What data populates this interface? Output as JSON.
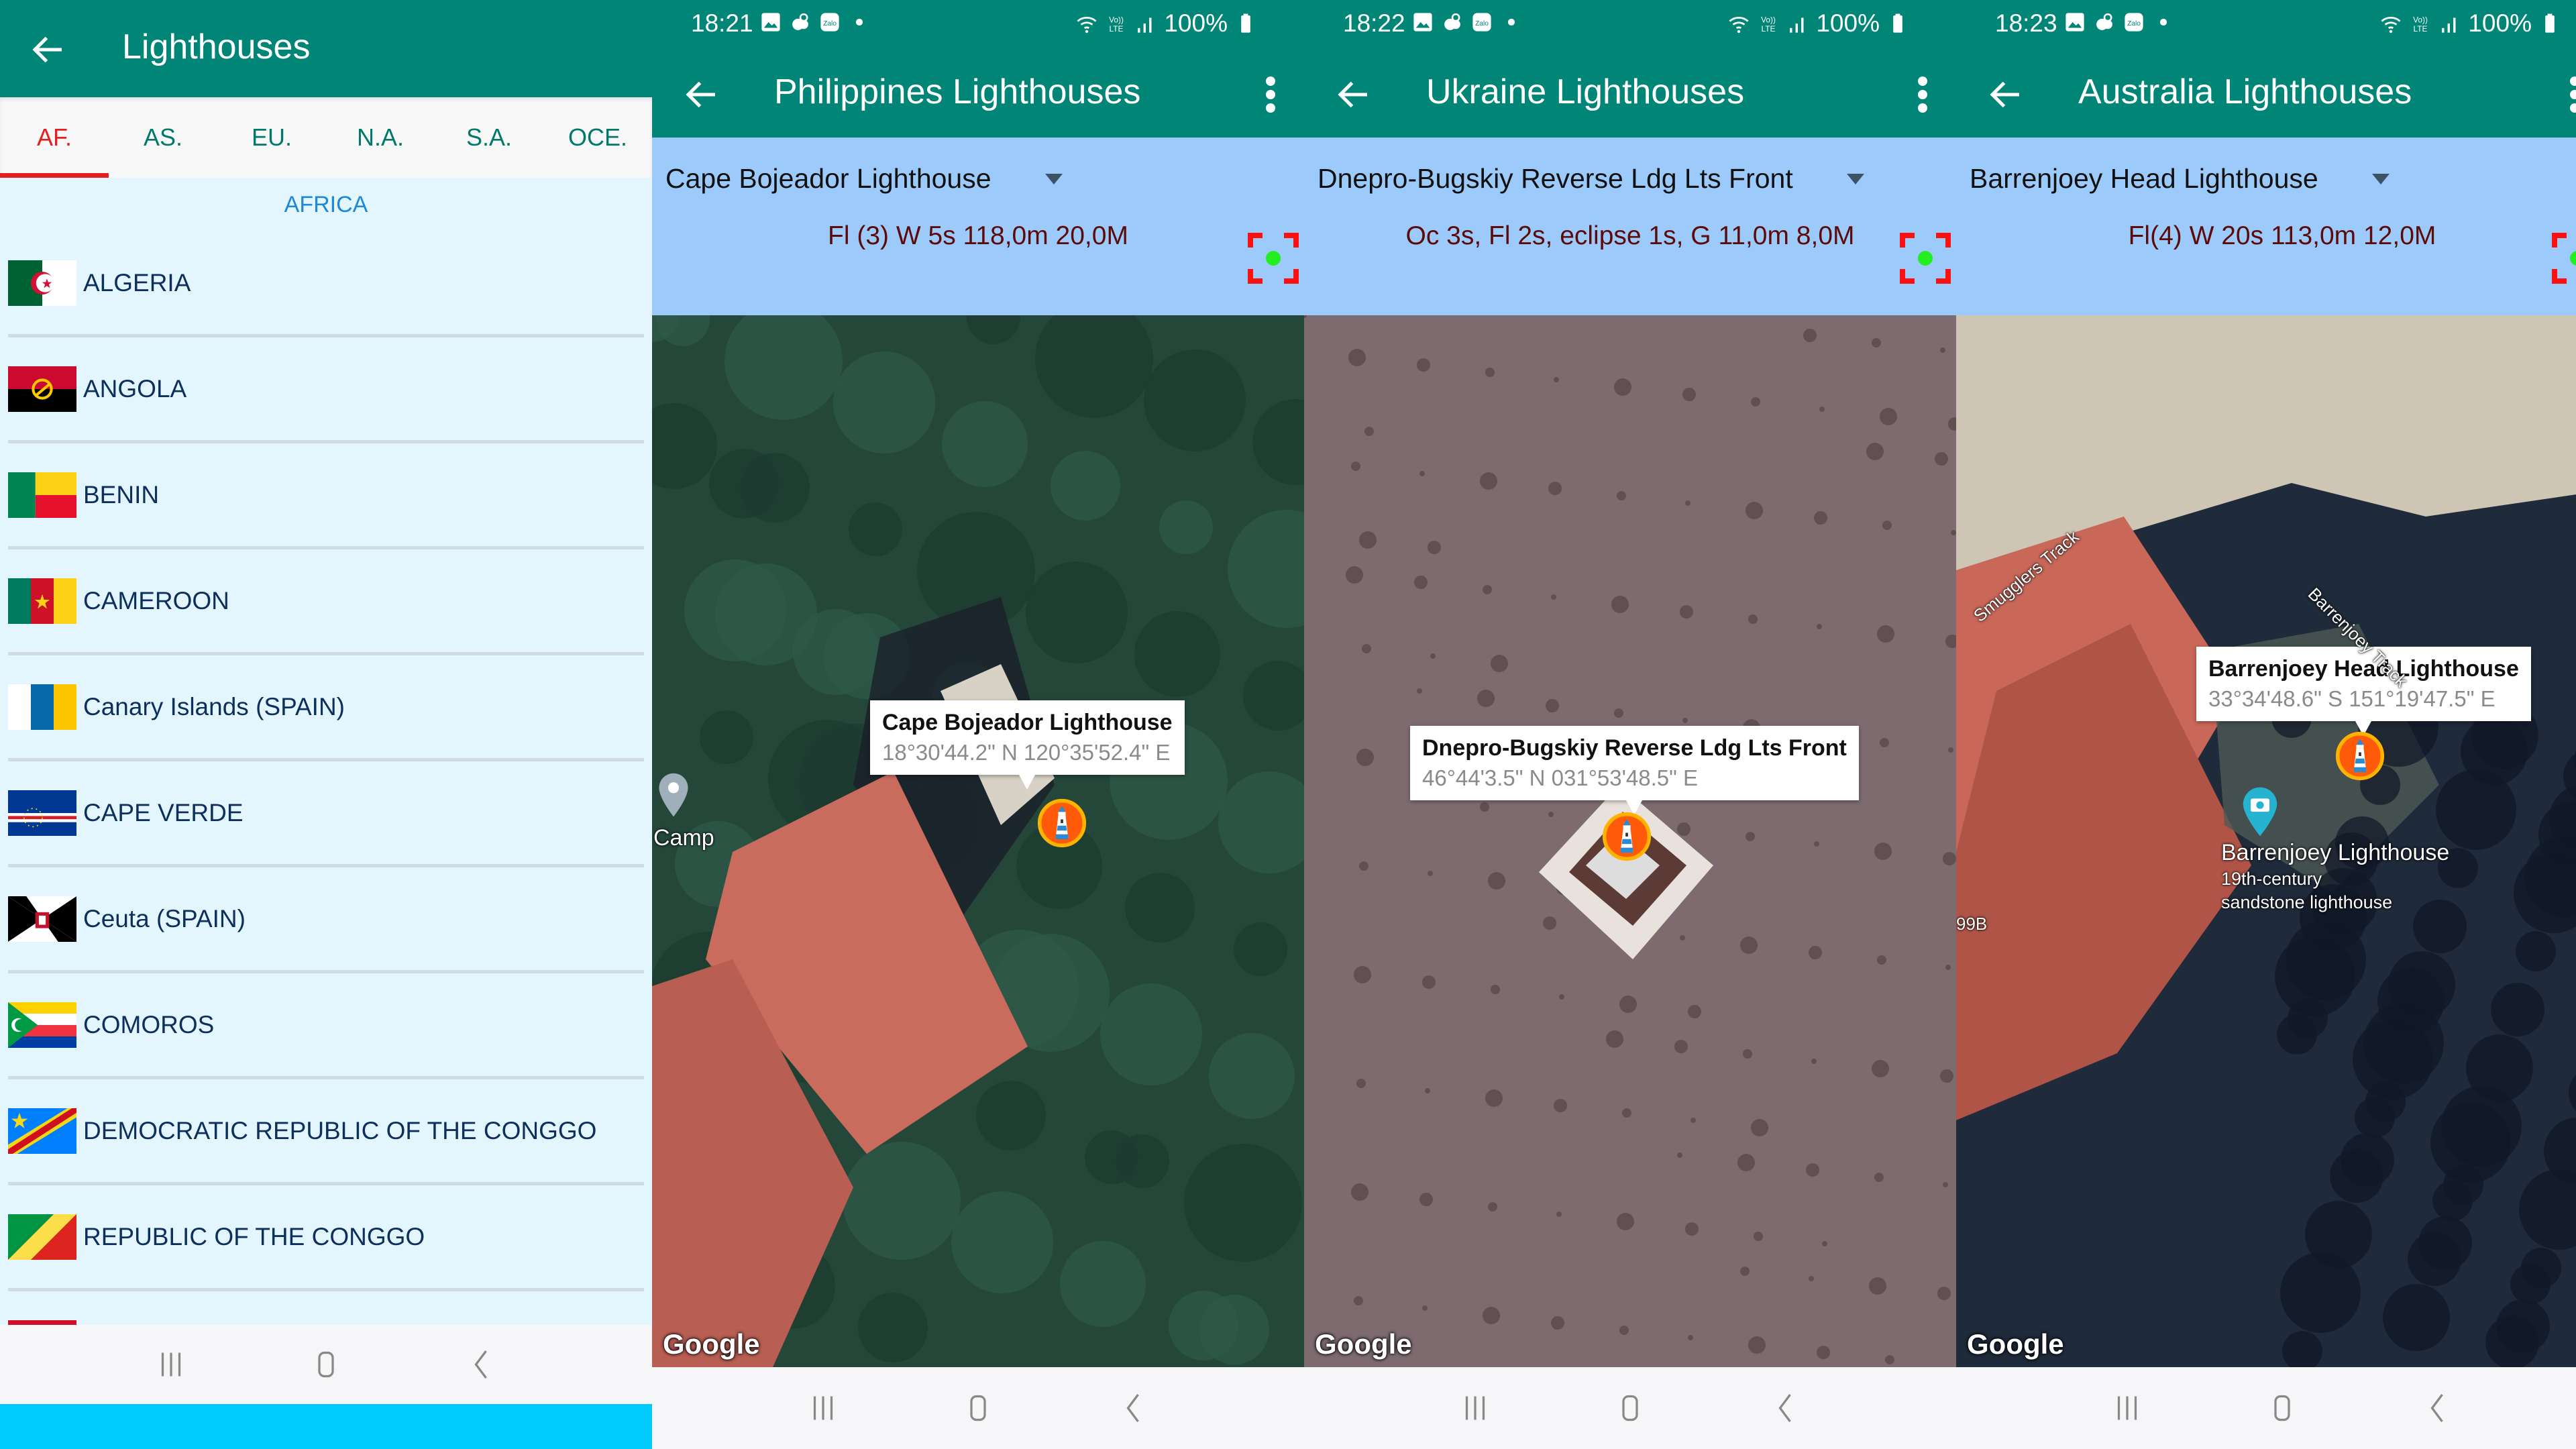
{
  "panel1": {
    "title": "Lighthouses",
    "tabs": [
      {
        "label": "AF.",
        "active": true
      },
      {
        "label": "AS.",
        "active": false
      },
      {
        "label": "EU.",
        "active": false
      },
      {
        "label": "N.A.",
        "active": false
      },
      {
        "label": "S.A.",
        "active": false
      },
      {
        "label": "OCE.",
        "active": false
      }
    ],
    "section_header": "AFRICA",
    "countries": [
      {
        "name": "ALGERIA",
        "flag": "algeria-flag"
      },
      {
        "name": "ANGOLA",
        "flag": "angola-flag"
      },
      {
        "name": "BENIN",
        "flag": "benin-flag"
      },
      {
        "name": "CAMEROON",
        "flag": "cameroon-flag"
      },
      {
        "name": "Canary Islands (SPAIN)",
        "flag": "canary-islands-flag"
      },
      {
        "name": "CAPE VERDE",
        "flag": "cape-verde-flag"
      },
      {
        "name": "Ceuta (SPAIN)",
        "flag": "ceuta-flag"
      },
      {
        "name": "COMOROS",
        "flag": "comoros-flag"
      },
      {
        "name": "DEMOCRATIC REPUBLIC OF THE CONGGO",
        "flag": "dr-congo-flag"
      },
      {
        "name": "REPUBLIC OF THE CONGGO",
        "flag": "congo-flag"
      },
      {
        "name": "",
        "flag": "partial-red-flag"
      }
    ]
  },
  "colors": {
    "toolbar": "#008577",
    "tab_active": "#e31f1f",
    "tab_inactive": "#00796b",
    "info_bg": "#9ccbfb",
    "characteristic_text": "#5c0a0a",
    "list_bg": "#e3f5fd",
    "marker_fill": "#ff5a0a",
    "marker_ring": "#ffb300"
  },
  "status_bar": {
    "battery": "100%",
    "network": "VoLTE"
  },
  "maps": [
    {
      "time": "18:21",
      "title": "Philippines Lighthouses",
      "selected_lighthouse": "Cape Bojeador Lighthouse",
      "characteristic": "Fl (3) W 5s 118,0m 20,0M",
      "bubble_title": "Cape Bojeador Lighthouse",
      "bubble_coords": "18°30'44.2\" N  120°35'52.4\" E",
      "map_labels": [
        "Camp"
      ],
      "attribution": "Google"
    },
    {
      "time": "18:22",
      "title": "Ukraine Lighthouses",
      "selected_lighthouse": "Dnepro-Bugskiy Reverse Ldg Lts  Front",
      "characteristic": "Oc 3s, Fl 2s, eclipse 1s, G 11,0m 8,0M",
      "bubble_title": "Dnepro-Bugskiy Reverse Ldg Lts  Front",
      "bubble_coords": "46°44'3.5\" N  031°53'48.5\" E",
      "map_labels": [],
      "attribution": "Google"
    },
    {
      "time": "18:23",
      "title": "Australia Lighthouses",
      "selected_lighthouse": "Barrenjoey Head Lighthouse",
      "characteristic": "Fl(4) W 20s 113,0m 12,0M",
      "bubble_title": "Barrenjoey Head Lighthouse",
      "bubble_coords": "33°34'48.6\" S  151°19'47.5\" E",
      "map_labels": [
        "Smugglers Track",
        "Barrenjoey Track",
        "Barrenjoey Lighthouse",
        "19th-century",
        "sandstone lighthouse",
        "99B"
      ],
      "attribution": "Google"
    }
  ]
}
